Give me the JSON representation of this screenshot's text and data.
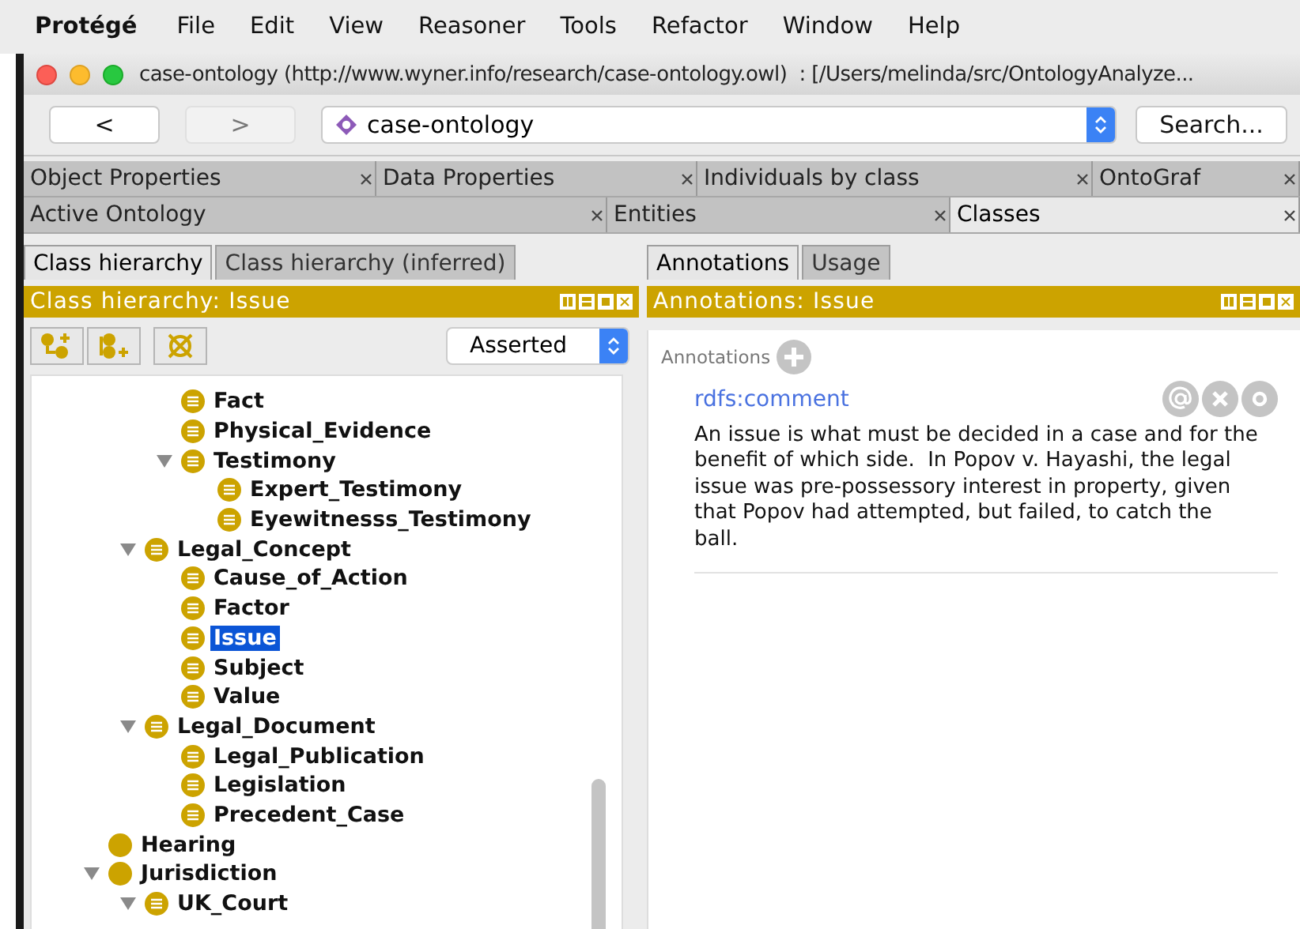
{
  "menu_bar": {
    "app": "Protégé",
    "items": [
      "File",
      "Edit",
      "View",
      "Reasoner",
      "Tools",
      "Refactor",
      "Window",
      "Help"
    ]
  },
  "window": {
    "title": "case-ontology (http://www.wyner.info/research/case-ontology.owl)  : [/Users/melinda/src/OntologyAnalyze..."
  },
  "toolbar": {
    "nav": [
      {
        "label": "<",
        "disabled": false
      },
      {
        "label": ">",
        "disabled": true
      }
    ],
    "ontology": "case-ontology",
    "search": "Search..."
  },
  "workspace_tabs": [
    [
      {
        "label": "Object Properties",
        "selected": false
      },
      {
        "label": "Data Properties",
        "selected": false
      },
      {
        "label": "Individuals by class",
        "selected": false
      },
      {
        "label": "OntoGraf",
        "selected": false
      }
    ],
    [
      {
        "label": "Active Ontology",
        "selected": false
      },
      {
        "label": "Entities",
        "selected": false
      },
      {
        "label": "Classes",
        "selected": true
      }
    ]
  ],
  "left_panel": {
    "tabs": [
      {
        "label": "Class hierarchy",
        "selected": true
      },
      {
        "label": "Class hierarchy (inferred)",
        "selected": false
      }
    ],
    "header": "Class hierarchy: Issue",
    "view_mode": "Asserted",
    "tree": [
      {
        "children": [
          {
            "children": [
              {
                "label": "Fact",
                "kind": "defined",
                "selected": false
              },
              {
                "label": "Physical_Evidence",
                "kind": "defined",
                "selected": false
              },
              {
                "label": "Testimony",
                "kind": "defined",
                "selected": false,
                "expanded": true,
                "children": [
                  {
                    "label": "Expert_Testimony",
                    "kind": "defined",
                    "selected": false
                  },
                  {
                    "label": "Eyewitnesss_Testimony",
                    "kind": "defined",
                    "selected": false
                  }
                ]
              }
            ]
          },
          {
            "label": "Legal_Concept",
            "kind": "defined",
            "selected": false,
            "expanded": true,
            "children": [
              {
                "label": "Cause_of_Action",
                "kind": "defined",
                "selected": false
              },
              {
                "label": "Factor",
                "kind": "defined",
                "selected": false
              },
              {
                "label": "Issue",
                "kind": "defined",
                "selected": true
              },
              {
                "label": "Subject",
                "kind": "defined",
                "selected": false
              },
              {
                "label": "Value",
                "kind": "defined",
                "selected": false
              }
            ]
          },
          {
            "label": "Legal_Document",
            "kind": "defined",
            "selected": false,
            "expanded": true,
            "children": [
              {
                "label": "Legal_Publication",
                "kind": "defined",
                "selected": false
              },
              {
                "label": "Legislation",
                "kind": "defined",
                "selected": false
              },
              {
                "label": "Precedent_Case",
                "kind": "defined",
                "selected": false
              }
            ]
          }
        ]
      },
      {
        "label": "Hearing",
        "kind": "primitive",
        "selected": false
      },
      {
        "label": "Jurisdiction",
        "kind": "primitive",
        "selected": false,
        "expanded": true,
        "children": [
          {
            "label": "UK_Court",
            "kind": "defined",
            "selected": false,
            "expanded": true
          }
        ]
      }
    ]
  },
  "right_panel": {
    "tabs": [
      {
        "label": "Annotations",
        "selected": true
      },
      {
        "label": "Usage",
        "selected": false
      }
    ],
    "header": "Annotations: Issue",
    "section": "Annotations",
    "annotations": [
      {
        "property": "rdfs:comment",
        "value": "An issue is what must be decided in a case and for the benefit of which side.  In Popov v. Hayashi, the legal issue was pre-possessory interest in property, given that Popov had attempted, but failed, to catch the ball."
      }
    ]
  }
}
